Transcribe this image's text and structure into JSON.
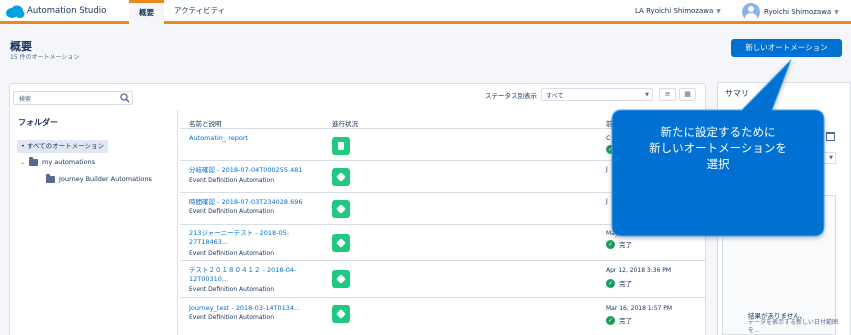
{
  "header": {
    "app_title": "Automation Studio",
    "tabs": [
      "概要",
      "アクティビティ"
    ],
    "business_unit": "LA Ryoichi Shimozawa",
    "user_name": "Ryoichi Shimozawa"
  },
  "page": {
    "title": "概要",
    "subtitle": "15 件のオートメーション",
    "new_button": "新しいオートメーション"
  },
  "toolbar": {
    "search_placeholder": "検索",
    "status_label": "ステータス別表示",
    "status_value": "すべて"
  },
  "folders": {
    "heading": "フォルダー",
    "all": "• すべてのオートメーション",
    "items": [
      "my automations",
      "Journey Builder Automations"
    ]
  },
  "table": {
    "columns": [
      "名前と説明",
      "進行状況",
      "前回"
    ],
    "rows": [
      {
        "name": "Automatin_ report",
        "description": "",
        "date": "",
        "status": "C"
      },
      {
        "name": "分岐確認 - 2018-07-04T000255.481",
        "description": "Event Definition Automation",
        "date": "J",
        "status": ""
      },
      {
        "name": "時間確認 - 2018-07-03T234028.696",
        "description": "Event Definition Automation",
        "date": "J",
        "status": ""
      },
      {
        "name": "213ジャーニーテスト - 2018-05-27T18463...",
        "description": "Event Definition Automation",
        "date": "May 2",
        "status": "完了"
      },
      {
        "name": "テスト２０１８０４１２ - 2018-04-12T00310...",
        "description": "Event Definition Automation",
        "date": "Apr 12, 2018 3:36 PM",
        "status": "完了"
      },
      {
        "name": "Journey_test - 2018-03-14T0134...",
        "description": "Event Definition Automation",
        "date": "Mar 16, 2018 1:57 PM",
        "status": "完了"
      }
    ]
  },
  "side": {
    "summary": "サマリ",
    "no_results": "結果がありません。",
    "no_results_sub": "データを表示する新しい日付範囲を..."
  },
  "callout": {
    "lines": [
      "新たに設定するために",
      "新しいオートメーションを",
      "選択"
    ]
  }
}
